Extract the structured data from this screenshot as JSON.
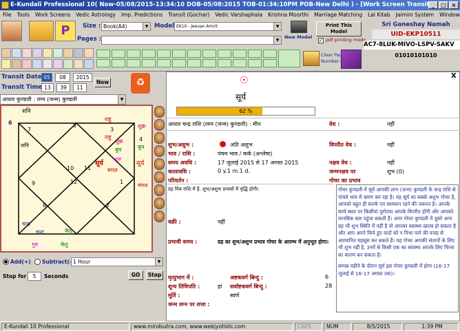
{
  "window": {
    "title": "E-Kundali Professional 10( Now-05/08/2015-13:34:10 DOB-05/08:2015 TOB-01:34:10PM POB-New Delhi ) - [Work Screen Transit]"
  },
  "menu": [
    "File",
    "Tools",
    "Work Screens",
    "Vedic Astrology",
    "Imp. Predictions",
    "Transit (Gochar)",
    "Vedic Varshaphala",
    "Krishna Moorthi",
    "Marriage Matching",
    "Lal Kitab",
    "Jaimini System",
    "Window"
  ],
  "toolbar": {
    "size_label": "Size :",
    "size_value": "Book(A4)",
    "model_label": "Model :",
    "model_value": "EK10 - Jeevan Amrit",
    "pages_label": "Pages :",
    "new_model": "New Model",
    "print_this_model": "Print This Model",
    "pdf_printing_mode": "pdf printing mode",
    "clear_page": "Clear Page",
    "number_log": "Number Log",
    "greeting": "Sri Ganeshay Namah",
    "uid": "UID-EKP10511",
    "license_code": "AC7-8LUK-MIVO-LSPV-SAKV",
    "serial": "01010101010"
  },
  "transit": {
    "date_label": "Transit Date",
    "day": "05",
    "month": "08",
    "year": "2015",
    "time_label": "Transit Time",
    "hour": "13",
    "minute": "39",
    "second": "11",
    "now_button": "Now",
    "chart_select": "आधार कुण्डली : लग्न (जन्म) कुण्डली"
  },
  "chart": {
    "houses": [
      "1",
      "2",
      "3",
      "4",
      "5",
      "6",
      "7",
      "8",
      "9",
      "10",
      "11",
      "12"
    ],
    "outer": [
      "शनि",
      "राहु",
      "शुक्र",
      "बुध",
      "सूर्य",
      "मंगल",
      "केतु",
      "चन्द्र",
      "गुरु"
    ],
    "inner": [
      "शनि",
      "राहु",
      "शुक्र",
      "बुध",
      "गुरु",
      "सूर्य",
      "मंगल",
      "चन्द्र",
      "केतु"
    ]
  },
  "controls": {
    "add": "Add(+)",
    "subtract": "Subtract(-)",
    "interval": "1 Hour",
    "stop_for": "Stop for",
    "seconds_value": "5",
    "seconds": "Seconds",
    "go": "GO",
    "stop": "Stop"
  },
  "detail": {
    "close": "X",
    "symbol": "☉",
    "planet": "सूर्य",
    "progress_percent": 62,
    "progress_label": "62 %",
    "row_base": "आधार चन्द्र राशि (लग्न (जन्म) कुण्डली) : मीन",
    "vedh_label": "वेध :",
    "vedh_value": "नहीं",
    "shubh_label": "शुभ/अशुभ :",
    "shubh_value": "अति अशुभ",
    "viprit_label": "विपरीत वेध :",
    "viprit_value": "नहीं",
    "bhav_label": "भाव / राशि :",
    "bhav_value": "पंचम भाव / कर्क (अश्लेषा)",
    "samay_label": "समय अवधि :",
    "samay_value": "17 जुलाई 2015 से 17 अगस्त 2015",
    "nakshatra_vedh_label": "नक्षत्र वेध :",
    "nakshatra_vedh_value": "नहीं",
    "kalavadhi_label": "कालावधि :",
    "kalavadhi_value": "0 y.1 m.1 d.",
    "janma_label": "जन्मनक्षत्र पर",
    "janma_value": "शुभ (0)",
    "gochar_label": "गोचर का प्रभाव",
    "parivartan_label": "परिवर्तन :",
    "note": "ग्रह मित्र राशि में है. शुभ/अशुभ प्रभावों में वृद्धि होगी।",
    "vakri_label": "वक्री :",
    "vakri_value": "नहीं",
    "prabhavi_label": "प्रभावी समय :",
    "prabhavi_value": "ग्रह का शुभ/अशुभ प्रभाव गोचर के आरम्भ में अनुभूत होगा।",
    "mrityu_label": "मृत्युभाग में :",
    "ashtak_label": "अष्टकवर्ग बिन्दु :",
    "ashtak_value": "6",
    "shunya_label": "शून्य तिथिपति :",
    "shunya_value": "हां",
    "sarvashtak_label": "सर्वाष्टकवर्ग बिन्दु :",
    "sarvashtak_value": "28",
    "murti_label": "मूर्ति :",
    "murti_value": "स्वर्ण",
    "janma_lagna_label": "जन्म लग्न पर लत्ता :",
    "right_text": "गोचर कुण्डली में सूर्य आपकी लग्न (जन्म) कुण्डली के चन्द्र राशि से पांचवे भाव में भ्रमण कर रहा है। यह सूर्य का सबसे अशुभ गोचर है, आपको बहुत ही सतर्क एवं सावधान रहने की जरूरत है। आपके कार्य स्थल पर किसीयां पूर्णतया आपके विपरीत होंगी और आपको मानसिक कष्ट पहुंचा सकती हैं। अगर गोचर कुण्डली में दूसरे अन्य ग्रह भी शुभ स्थिति में नहीं है तो आपका स्वास्थ्य खराब हो सकता है और आप अपने किये हुए वादों को न निभा पाने की वजह से अपमानित महसूस कर सकते हैं। यह गोचर आपकी संतानों के लिए भी शुभ नहीं है, उनमें से किसी एक का स्वास्थ्य आपके लिए चिन्ता का कारण बन सकता है।",
    "right_text2": "सम्पन्न महीने के दौरान सूर्य इस गोचर कुण्डली में होगा (16-17 जुलाई से 16-17 अगस्त तक)।"
  },
  "status": {
    "app": "E-Kundali 10 Professional",
    "web": "www.mindsutra.com, www.webjyotishi.com",
    "caps": "CAPS",
    "num": "NUM",
    "date": "8/5/2015",
    "time": "1:39 PM"
  }
}
